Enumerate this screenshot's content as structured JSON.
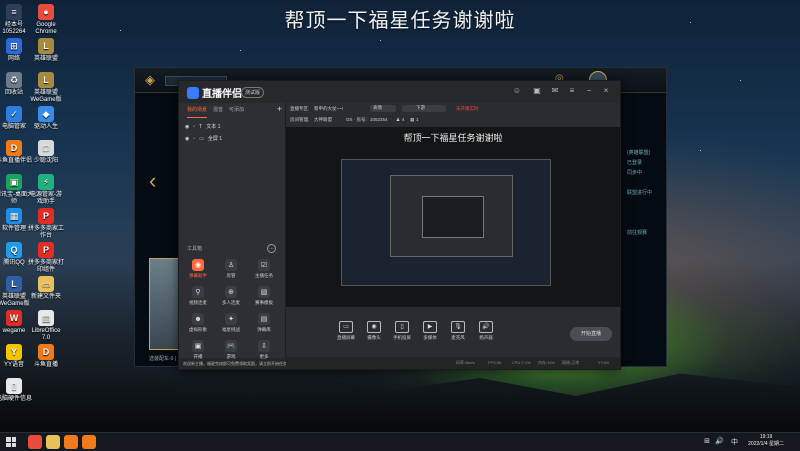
{
  "overlay_title": "帮顶一下福星任务谢谢啦",
  "desktop_icons": [
    {
      "label": "经本号",
      "sub": "1052264",
      "color": "#2f3e56",
      "glyph": "≡"
    },
    {
      "label": "Google",
      "sub": "Chrome",
      "color": "#e94b3c",
      "glyph": "●"
    },
    {
      "label": "网络",
      "sub": "",
      "color": "#2a6ad8",
      "glyph": "⊞"
    },
    {
      "label": "英雄联盟",
      "sub": "",
      "color": "#a88a3c",
      "glyph": "L"
    },
    {
      "label": "回收站",
      "sub": "",
      "color": "#6c7a8a",
      "glyph": "♻"
    },
    {
      "label": "英雄联盟",
      "sub": "WeGame版",
      "color": "#a88a3c",
      "glyph": "L"
    },
    {
      "label": "电脑管家",
      "sub": "",
      "color": "#2e7de0",
      "glyph": "✓"
    },
    {
      "label": "驱动人生",
      "sub": "",
      "color": "#3a8be8",
      "glyph": "◆"
    },
    {
      "label": "斗鱼直播伴侣",
      "sub": "",
      "color": "#f07a1a",
      "glyph": "D"
    },
    {
      "label": "少聪沈阳",
      "sub": "",
      "color": "#d9d9d9",
      "glyph": "□"
    },
    {
      "label": "腾讯宝-桌面大",
      "sub": "师",
      "color": "#19a35b",
      "glyph": "▣"
    },
    {
      "label": "电源管家-游",
      "sub": "戏助手",
      "color": "#20b07c",
      "glyph": "⚡"
    },
    {
      "label": "软件管理",
      "sub": "",
      "color": "#1f8ce6",
      "glyph": "▦"
    },
    {
      "label": "拼多多商家工",
      "sub": "作台",
      "color": "#e02e24",
      "glyph": "P"
    },
    {
      "label": "腾讯QQ",
      "sub": "",
      "color": "#1e9cee",
      "glyph": "Q"
    },
    {
      "label": "拼多多商家打",
      "sub": "印组件",
      "color": "#e02e24",
      "glyph": "P"
    },
    {
      "label": "英雄联盟",
      "sub": "WeGame版",
      "color": "#2f5fa5",
      "glyph": "L"
    },
    {
      "label": "新建文件夹",
      "sub": "",
      "color": "#e8c15a",
      "glyph": "▭"
    },
    {
      "label": "wegame",
      "sub": "",
      "color": "#e02e24",
      "glyph": "W"
    },
    {
      "label": "LibreOffice",
      "sub": "7.0",
      "color": "#e8e8e8",
      "glyph": "▤"
    },
    {
      "label": "YY语音",
      "sub": "",
      "color": "#f5c400",
      "glyph": "Y"
    },
    {
      "label": "斗鱼直播",
      "sub": "",
      "color": "#f07a1a",
      "glyph": "D"
    },
    {
      "label": "电脑硬件信息",
      "sub": "",
      "color": "#e8e8e8",
      "glyph": "▯"
    }
  ],
  "game": {
    "right_text": [
      "(英雄联盟)",
      "已登录",
      "同步中",
      "",
      "联盟进行中",
      "",
      "",
      "",
      "前往观赛"
    ],
    "bottom_text": "选装配车-9 | 用机"
  },
  "app": {
    "logo": "直播伴侣",
    "version": "测试版",
    "sidebar_tabs": [
      "我的场景",
      "混音",
      "可添加"
    ],
    "add": "+",
    "scenes": [
      "文本 1",
      "全屏 1"
    ],
    "tools_label": "工具箱",
    "tools": [
      {
        "label": "弹幕助手",
        "glyph": "◉",
        "accent": true
      },
      {
        "label": "房管",
        "glyph": "♙",
        "accent": false
      },
      {
        "label": "主播任务",
        "glyph": "☑",
        "accent": false
      },
      {
        "label": "视频连麦",
        "glyph": "⚲",
        "accent": false
      },
      {
        "label": "多人连麦",
        "glyph": "⊕",
        "accent": false
      },
      {
        "label": "赛事模板",
        "glyph": "▧",
        "accent": false
      },
      {
        "label": "虚拟形象",
        "glyph": "☻",
        "accent": false
      },
      {
        "label": "福星挑战",
        "glyph": "✦",
        "accent": false
      },
      {
        "label": "弹幕库",
        "glyph": "▤",
        "accent": false
      },
      {
        "label": "开播",
        "glyph": "▣",
        "accent": false
      },
      {
        "label": "游戏",
        "glyph": "🎮",
        "accent": false
      },
      {
        "label": "更多",
        "glyph": "⇩",
        "accent": false
      }
    ],
    "notice": "欢迎新主播，福星完成即可免费领取奖励，请立即开始任务签到",
    "toolbar": {
      "category_label": "直播专区:",
      "category": "蔡申的大仗~~!",
      "search_btn": "表情",
      "type": "下游",
      "live_status": "未开播实时",
      "room_label": "房间管理:",
      "room": "大神联盟",
      "id_label": "OS · 房号:",
      "id": "1052254",
      "fans": "4",
      "online": "1"
    },
    "preview_title": "帮顶一下福星任务谢谢啦",
    "bottom_buttons": [
      {
        "label": "直播屏幕",
        "glyph": "▭"
      },
      {
        "label": "摄像头",
        "glyph": "◉"
      },
      {
        "label": "手机投屏",
        "glyph": "▯"
      },
      {
        "label": "多媒体",
        "glyph": "▶"
      },
      {
        "label": "麦克风",
        "glyph": "🎙"
      },
      {
        "label": "扬声器",
        "glyph": "🔊"
      }
    ],
    "start_live": "开始直播",
    "status": {
      "bitrate": "码率:0kb/s",
      "fps": "FPS:30",
      "cpu": "CPU:7.1%",
      "mem": "内存:44%",
      "net": "网络:正常",
      "time": "YY:IM"
    }
  },
  "taskbar": {
    "time": "19:19",
    "date": "2022/1/4 星期二",
    "apps": [
      {
        "color": "#e94b3c"
      },
      {
        "color": "#e8c15a"
      },
      {
        "color": "#f07a1a"
      },
      {
        "color": "#f07a1a"
      }
    ]
  }
}
